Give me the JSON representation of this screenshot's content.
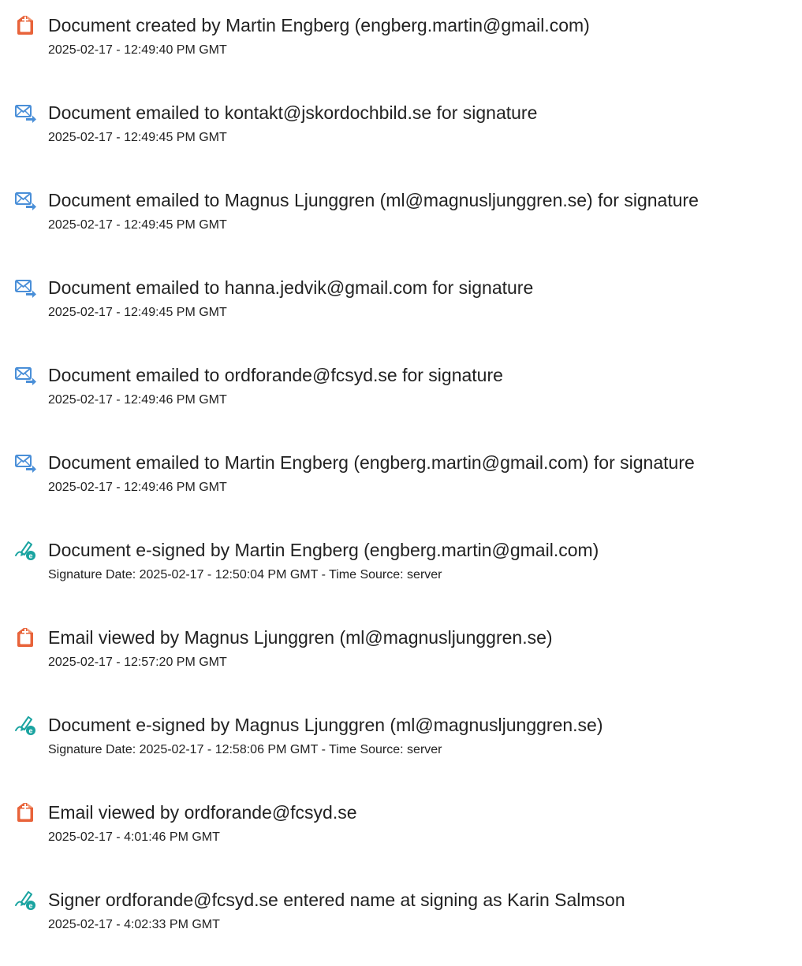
{
  "events": [
    {
      "icon": "document-created-icon",
      "title": "Document created by Martin Engberg (engberg.martin@gmail.com)",
      "date": "2025-02-17 - 12:49:40 PM GMT"
    },
    {
      "icon": "email-sent-icon",
      "title": "Document emailed to kontakt@jskordochbild.se for signature",
      "date": "2025-02-17 - 12:49:45 PM GMT"
    },
    {
      "icon": "email-sent-icon",
      "title": "Document emailed to Magnus Ljunggren (ml@magnusljunggren.se) for signature",
      "date": "2025-02-17 - 12:49:45 PM GMT"
    },
    {
      "icon": "email-sent-icon",
      "title": "Document emailed to hanna.jedvik@gmail.com for signature",
      "date": "2025-02-17 - 12:49:45 PM GMT"
    },
    {
      "icon": "email-sent-icon",
      "title": "Document emailed to ordforande@fcsyd.se for signature",
      "date": "2025-02-17 - 12:49:46 PM GMT"
    },
    {
      "icon": "email-sent-icon",
      "title": "Document emailed to Martin Engberg (engberg.martin@gmail.com) for signature",
      "date": "2025-02-17 - 12:49:46 PM GMT"
    },
    {
      "icon": "e-sign-pen-icon",
      "title": "Document e-signed by Martin Engberg (engberg.martin@gmail.com)",
      "date": "Signature Date: 2025-02-17 - 12:50:04 PM GMT - Time Source: server"
    },
    {
      "icon": "document-viewed-icon",
      "title": "Email viewed by Magnus Ljunggren (ml@magnusljunggren.se)",
      "date": "2025-02-17 - 12:57:20 PM GMT"
    },
    {
      "icon": "e-sign-pen-icon",
      "title": "Document e-signed by Magnus Ljunggren (ml@magnusljunggren.se)",
      "date": "Signature Date: 2025-02-17 - 12:58:06 PM GMT - Time Source: server"
    },
    {
      "icon": "document-viewed-icon",
      "title": "Email viewed by ordforande@fcsyd.se",
      "date": "2025-02-17 - 4:01:46 PM GMT"
    },
    {
      "icon": "e-sign-pen-icon",
      "title": "Signer ordforande@fcsyd.se entered name at signing as Karin Salmson",
      "date": "2025-02-17 - 4:02:33 PM GMT"
    }
  ],
  "colors": {
    "document_icon": "#e8633a",
    "email_icon": "#4a8fd8",
    "pen_icon": "#19a3a0",
    "text": "#222222"
  }
}
